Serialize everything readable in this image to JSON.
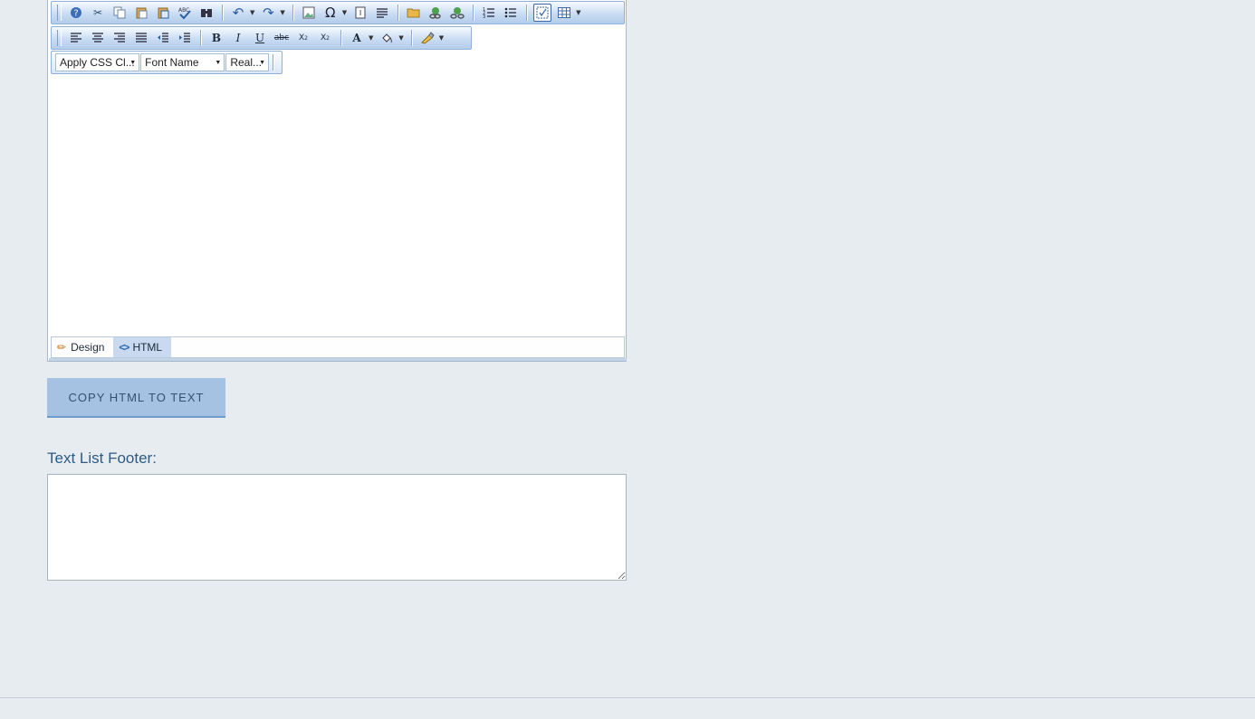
{
  "editor": {
    "toolbar1": [
      {
        "icon": "help-icon",
        "glyph": "?"
      },
      {
        "icon": "cut-icon",
        "glyph": "✂"
      },
      {
        "icon": "copy-icon",
        "glyph": "❐"
      },
      {
        "icon": "paste-icon",
        "glyph": "📋"
      },
      {
        "icon": "paste-from-word-icon",
        "glyph": "📋"
      },
      {
        "icon": "spellcheck-icon",
        "glyph": "✓"
      },
      {
        "icon": "find-replace-icon",
        "glyph": "⌕"
      },
      {
        "icon": "undo-icon",
        "glyph": "↶",
        "dropdown": true
      },
      {
        "icon": "redo-icon",
        "glyph": "↷",
        "dropdown": true
      },
      {
        "icon": "image-manager-icon",
        "glyph": "▣"
      },
      {
        "icon": "special-characters-icon",
        "glyph": "Ω",
        "dropdown": true
      },
      {
        "icon": "form-element-icon",
        "glyph": "▤"
      },
      {
        "icon": "paragraph-icon",
        "glyph": "☰"
      },
      {
        "icon": "document-manager-icon",
        "glyph": "❏"
      },
      {
        "icon": "hyperlink-icon",
        "glyph": "⚭"
      },
      {
        "icon": "remove-link-icon",
        "glyph": "⚮"
      },
      {
        "icon": "numbered-list-icon",
        "glyph": "≡"
      },
      {
        "icon": "bulleted-list-icon",
        "glyph": "≔"
      },
      {
        "icon": "toggle-border-icon",
        "glyph": "☑",
        "active": true
      },
      {
        "icon": "insert-table-icon",
        "glyph": "▦",
        "dropdown": true
      }
    ],
    "toolbar2": [
      {
        "icon": "align-left-icon",
        "glyph": "≡"
      },
      {
        "icon": "align-center-icon",
        "glyph": "≡"
      },
      {
        "icon": "align-right-icon",
        "glyph": "≡"
      },
      {
        "icon": "justify-icon",
        "glyph": "≣"
      },
      {
        "icon": "outdent-icon",
        "glyph": "⇤"
      },
      {
        "icon": "indent-icon",
        "glyph": "⇥"
      },
      {
        "icon": "bold-icon",
        "glyph": "B"
      },
      {
        "icon": "italic-icon",
        "glyph": "I"
      },
      {
        "icon": "underline-icon",
        "glyph": "U"
      },
      {
        "icon": "strikethrough-icon",
        "glyph": "abc"
      },
      {
        "icon": "subscript-icon",
        "glyph": "X₂"
      },
      {
        "icon": "superscript-icon",
        "glyph": "X²"
      },
      {
        "icon": "font-color-icon",
        "glyph": "A",
        "dropdown": true
      },
      {
        "icon": "background-color-icon",
        "glyph": "◈",
        "dropdown": true
      },
      {
        "icon": "format-stripper-icon",
        "glyph": "✎",
        "dropdown": true
      }
    ],
    "toolbar3": {
      "css_class": "Apply CSS Cl...",
      "font_name": "Font Name",
      "font_size": "Real..."
    },
    "modes": {
      "design": "Design",
      "html": "HTML"
    },
    "content": ""
  },
  "copy_button": "COPY HTML TO TEXT",
  "footer": {
    "label": "Text List Footer:",
    "value": ""
  }
}
